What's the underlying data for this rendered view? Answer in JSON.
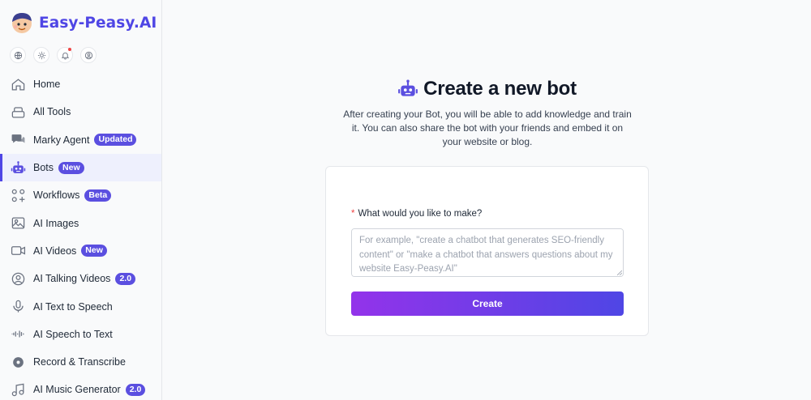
{
  "brand": {
    "name": "Easy-Peasy.AI",
    "accent": "#4f46e5"
  },
  "utility_icons": [
    "globe-icon",
    "sun-icon",
    "bell-icon",
    "user-circle-icon"
  ],
  "sidebar": {
    "items": [
      {
        "label": "Home",
        "icon": "home-icon"
      },
      {
        "label": "All Tools",
        "icon": "tools-icon"
      },
      {
        "label": "Marky Agent",
        "icon": "chat-icon",
        "badge": "Updated"
      },
      {
        "label": "Bots",
        "icon": "robot-icon",
        "badge": "New",
        "active": true
      },
      {
        "label": "Workflows",
        "icon": "workflow-icon",
        "badge": "Beta"
      },
      {
        "label": "AI Images",
        "icon": "image-icon"
      },
      {
        "label": "AI Videos",
        "icon": "video-icon",
        "badge": "New"
      },
      {
        "label": "AI Talking Videos",
        "icon": "user-circle-icon",
        "badge": "2.0"
      },
      {
        "label": "AI Text to Speech",
        "icon": "microphone-icon"
      },
      {
        "label": "AI Speech to Text",
        "icon": "waveform-icon"
      },
      {
        "label": "Record & Transcribe",
        "icon": "record-icon"
      },
      {
        "label": "AI Music Generator",
        "icon": "music-icon",
        "badge": "2.0"
      }
    ]
  },
  "main": {
    "title": "Create a new bot",
    "description": "After creating your Bot, you will be able to add knowledge and train it. You can also share the bot with your friends and embed it on your website or blog.",
    "form": {
      "required_mark": "*",
      "label": "What would you like to make?",
      "placeholder": "For example, \"create a chatbot that generates SEO-friendly content\" or \"make a chatbot that answers questions about my website Easy-Peasy.AI\"",
      "value": "",
      "submit_label": "Create"
    }
  }
}
